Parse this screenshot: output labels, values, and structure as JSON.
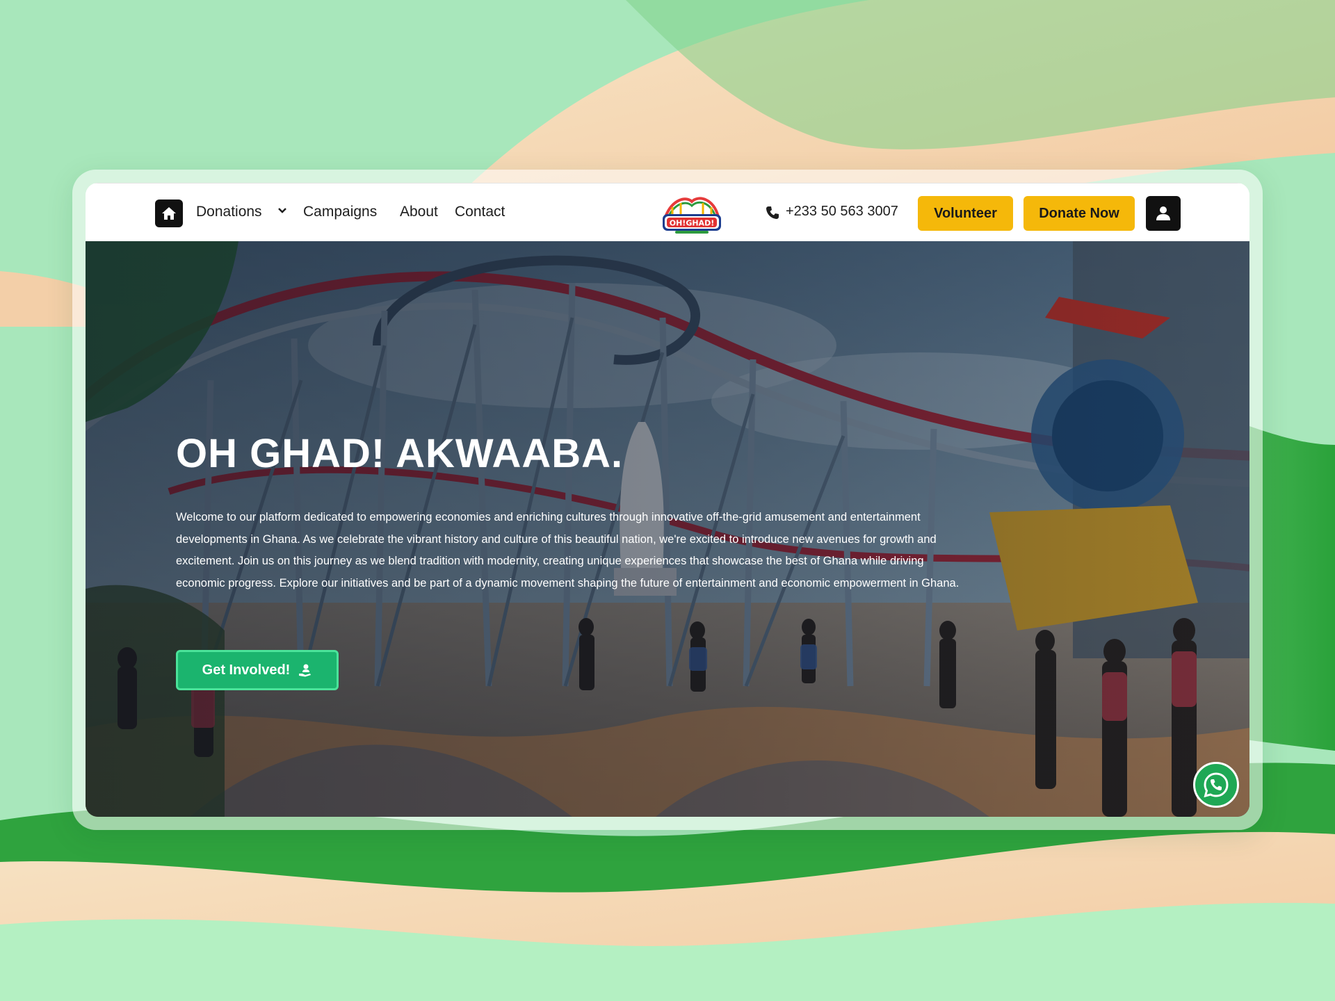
{
  "nav": {
    "home_icon": "home-icon",
    "links": [
      {
        "label": "Donations",
        "has_dropdown": true
      },
      {
        "label": "Campaigns"
      },
      {
        "label": "About"
      },
      {
        "label": "Contact"
      }
    ],
    "logo_text": "OH!GHAD!",
    "phone_icon": "phone-icon",
    "phone": "+233 50 563 3007",
    "volunteer_label": "Volunteer",
    "donate_label": "Donate Now",
    "user_icon": "user-icon"
  },
  "hero": {
    "title": "OH GHAD! AKWAABA.",
    "description": "Welcome to our platform dedicated to empowering economies and enriching cultures through innovative off-the-grid amusement and entertainment developments in Ghana. As we celebrate the vibrant history and culture of this beautiful nation, we're excited to introduce new avenues for growth and excitement. Join us on this journey as we blend tradition with modernity, creating unique experiences that showcase the best of Ghana while driving economic progress. Explore our initiatives and be part of a dynamic movement shaping the future of entertainment and economic empowerment in Ghana.",
    "cta_label": "Get Involved!",
    "cta_icon": "hand-person-icon",
    "chat_icon": "whatsapp-icon"
  },
  "colors": {
    "accent_yellow": "#f5b80a",
    "accent_green": "#1bb46e",
    "whatsapp_green": "#1fa855",
    "dark": "#111111"
  }
}
